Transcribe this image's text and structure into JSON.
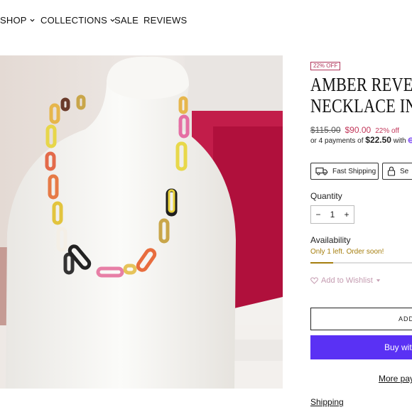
{
  "nav": {
    "items": [
      {
        "label": "SHOP",
        "dropdown": true
      },
      {
        "label": "COLLECTIONS",
        "dropdown": true
      },
      {
        "label": "SALE",
        "dropdown": false
      },
      {
        "label": "REVIEWS",
        "dropdown": false
      }
    ]
  },
  "product": {
    "badge": "22% OFF",
    "title_line1": "AMBER REVER",
    "title_line2": "NECKLACE IN",
    "compare_price": "$115.00",
    "price": "$90.00",
    "discount": "22% off",
    "installment_prefix": "or 4 payments of ",
    "installment_amount": "$22.50",
    "installment_suffix": " with ",
    "installment_provider_partial": "s"
  },
  "features": [
    {
      "label": "Fast Shipping",
      "icon": "truck-icon"
    },
    {
      "label": "Se",
      "icon": "lock-icon"
    }
  ],
  "quantity": {
    "label": "Quantity",
    "value": "1",
    "minus": "−",
    "plus": "+"
  },
  "availability": {
    "label": "Availability",
    "note": "Only 1 left. Order soon!",
    "stock_fraction": 0.2
  },
  "wishlist": {
    "label": "Add to Wishlist"
  },
  "buttons": {
    "add_to_cart": "ADD",
    "buy_now": "Buy with",
    "more_payment": "More pay"
  },
  "links": {
    "shipping": "Shipping"
  },
  "colors": {
    "sale": "#c2385b",
    "stock": "#a57e0e",
    "buy_button": "#5a31f4",
    "wishlist": "#c49bb0"
  }
}
